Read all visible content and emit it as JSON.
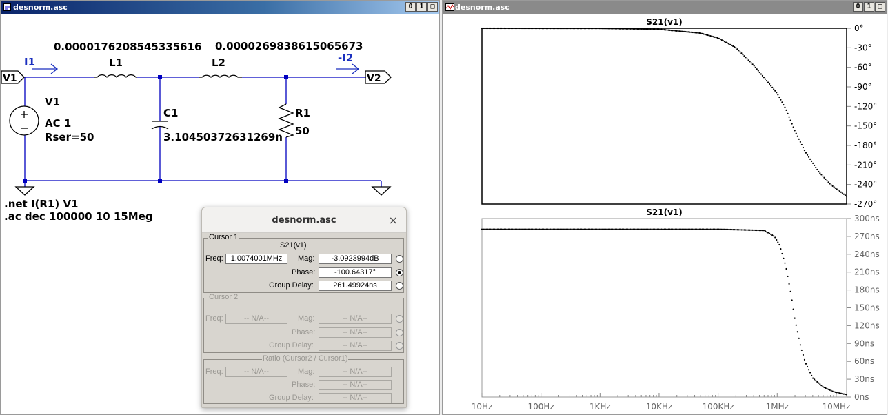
{
  "schematic_window": {
    "title": "desnorm.asc",
    "buttons": [
      "0",
      "1",
      ""
    ],
    "labels": {
      "i1": "I1",
      "i2": "-I2",
      "v1_port": "V1",
      "v2_port": "V2",
      "l1": "L1",
      "l1_value": "0.0000176208545335616",
      "l2": "L2",
      "l2_value": "0.0000269838615065673",
      "c1": "C1",
      "c1_value": "3.10450372631269n",
      "r1": "R1",
      "r1_value": "50",
      "v1_name": "V1",
      "v1_ac": "AC 1",
      "v1_rser": "Rser=50",
      "net_directive": ".net I(R1) V1",
      "ac_directive": ".ac dec 100000 10 15Meg"
    },
    "colors": {
      "wire": "#0000c0",
      "label_blue": "#1a2fbf",
      "title_active": "#0a246a"
    }
  },
  "waveform_window": {
    "title": "desnorm.asc",
    "buttons": [
      "0",
      "1",
      ""
    ],
    "colors": {
      "title_inactive": "#8a8a8a",
      "trace": "#000000",
      "axis": "#888888"
    }
  },
  "cursor_dialog": {
    "title": "desnorm.asc",
    "close": "×",
    "cursor1": {
      "legend": "Cursor 1",
      "trace": "S21(v1)",
      "freq_label": "Freq:",
      "freq": "1.0074001MHz",
      "mag_label": "Mag:",
      "mag": "-3.0923994dB",
      "phase_label": "Phase:",
      "phase": "-100.64317°",
      "gd_label": "Group Delay:",
      "gd": "261.49924ns",
      "selected": "phase"
    },
    "cursor2": {
      "legend": "Cursor 2",
      "freq_label": "Freq:",
      "freq": "-- N/A--",
      "mag_label": "Mag:",
      "mag": "-- N/A--",
      "phase_label": "Phase:",
      "phase": "-- N/A--",
      "gd_label": "Group Delay:",
      "gd": "-- N/A--"
    },
    "ratio": {
      "legend": "Ratio (Cursor2 / Cursor1)",
      "freq_label": "Freq:",
      "freq": "-- N/A--",
      "mag_label": "Mag:",
      "mag": "-- N/A--",
      "phase_label": "Phase:",
      "phase": "-- N/A--",
      "gd_label": "Group Delay:",
      "gd": "-- N/A--"
    }
  },
  "chart_data": [
    {
      "type": "line",
      "title": "S21(v1)",
      "xscale": "log",
      "xlim": [
        10,
        15000000
      ],
      "x_ticks": [
        "10Hz",
        "100Hz",
        "1KHz",
        "10KHz",
        "100KHz",
        "1MHz",
        "10MHz"
      ],
      "ylim": [
        -270,
        0
      ],
      "y_ticks": [
        "0°",
        "-30°",
        "-60°",
        "-90°",
        "-120°",
        "-150°",
        "-180°",
        "-210°",
        "-240°",
        "-270°"
      ],
      "y_axis_side": "right",
      "line_style": "dotted",
      "series": [
        {
          "quantity": "phase",
          "x": [
            10,
            1000,
            10000,
            50000,
            100000,
            200000,
            400000,
            700000,
            1000000,
            1400000,
            2000000,
            3000000,
            5000000,
            8000000,
            15000000
          ],
          "y": [
            0,
            -0.2,
            -1.5,
            -7.5,
            -15,
            -30,
            -57,
            -83,
            -100,
            -124,
            -158,
            -190,
            -220,
            -240,
            -258
          ]
        }
      ]
    },
    {
      "type": "line",
      "title": "S21(v1)",
      "xscale": "log",
      "xlim": [
        10,
        15000000
      ],
      "x_ticks": [
        "10Hz",
        "100Hz",
        "1KHz",
        "10KHz",
        "100KHz",
        "1MHz",
        "10MHz"
      ],
      "ylim": [
        0,
        300
      ],
      "y_ticks": [
        "300ns",
        "270ns",
        "240ns",
        "210ns",
        "180ns",
        "150ns",
        "120ns",
        "90ns",
        "60ns",
        "30ns",
        "0ns"
      ],
      "y_axis_side": "right",
      "line_style": "dotted",
      "series": [
        {
          "quantity": "group delay",
          "x": [
            10,
            100000,
            600000,
            900000,
            1100000,
            1400000,
            1700000,
            2000000,
            2500000,
            3000000,
            4000000,
            6000000,
            9000000,
            15000000
          ],
          "y": [
            282,
            282,
            280,
            270,
            255,
            220,
            175,
            130,
            85,
            58,
            32,
            17,
            9,
            4
          ]
        }
      ]
    }
  ]
}
